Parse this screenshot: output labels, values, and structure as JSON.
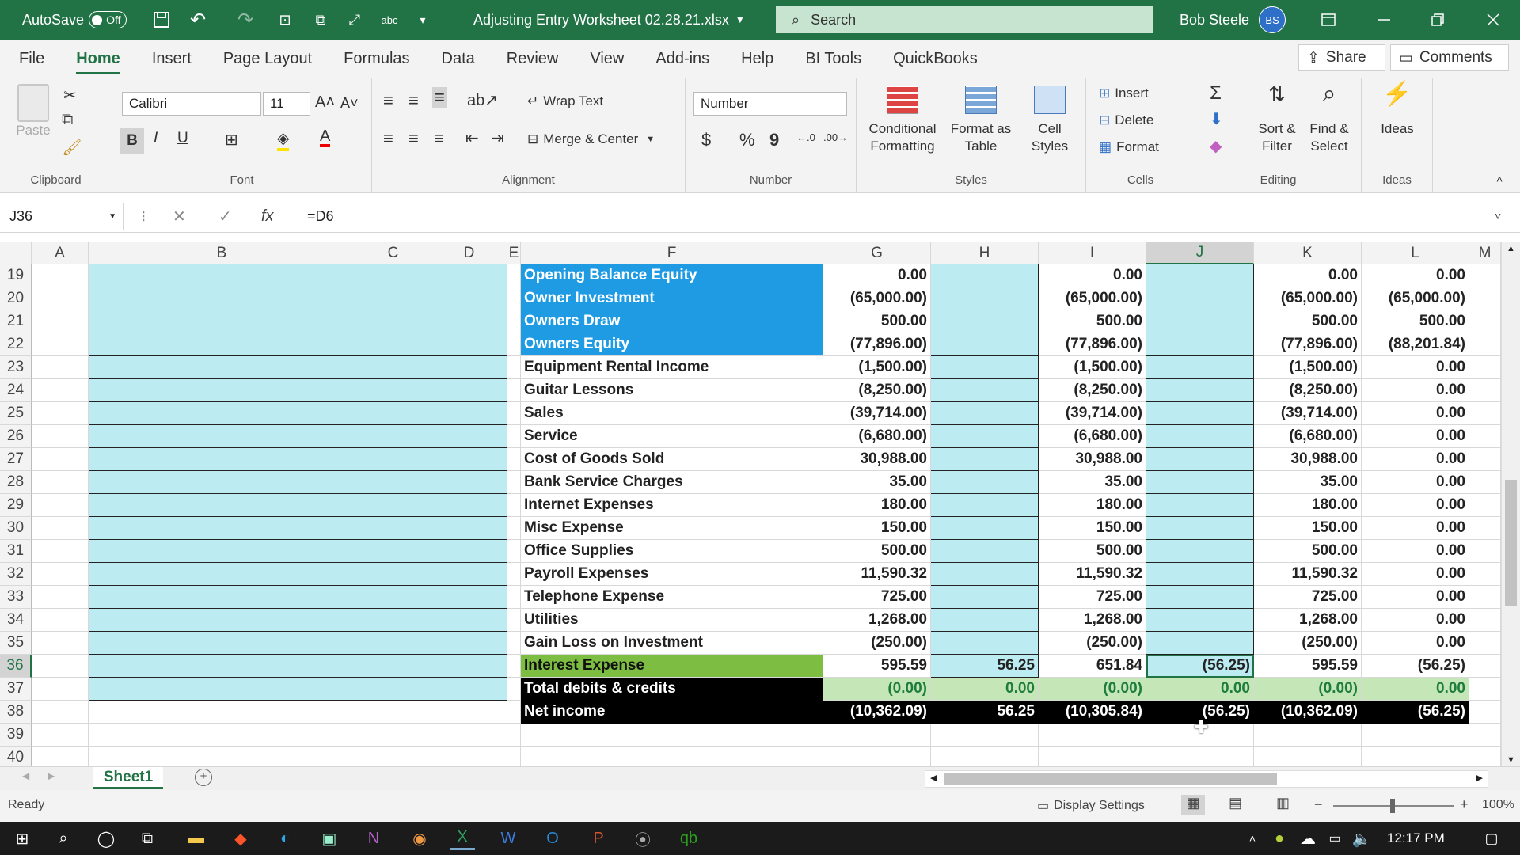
{
  "titlebar": {
    "autosave_label": "AutoSave",
    "autosave_state": "Off",
    "filename": "Adjusting Entry Worksheet 02.28.21.xlsx",
    "search_placeholder": "Search",
    "user_name": "Bob Steele",
    "user_initials": "BS"
  },
  "menu": {
    "items": [
      "File",
      "Home",
      "Insert",
      "Page Layout",
      "Formulas",
      "Data",
      "Review",
      "View",
      "Add-ins",
      "Help",
      "BI Tools",
      "QuickBooks"
    ],
    "share": "Share",
    "comments": "Comments"
  },
  "ribbon": {
    "clipboard": {
      "paste": "Paste",
      "label": "Clipboard"
    },
    "font": {
      "name": "Calibri",
      "size": "11",
      "label": "Font",
      "bold": "B",
      "italic": "I",
      "underline": "U"
    },
    "alignment": {
      "wrap": "Wrap Text",
      "merge": "Merge & Center",
      "label": "Alignment"
    },
    "number": {
      "format": "Number",
      "label": "Number",
      "currency": "$",
      "percent": "%",
      "comma": "9"
    },
    "styles": {
      "conditional": "Conditional",
      "conditional2": "Formatting",
      "format_table": "Format as",
      "format_table2": "Table",
      "cell_styles": "Cell",
      "cell_styles2": "Styles",
      "label": "Styles"
    },
    "cells": {
      "insert": "Insert",
      "delete": "Delete",
      "format": "Format",
      "label": "Cells"
    },
    "editing": {
      "sort": "Sort &",
      "sort2": "Filter",
      "find": "Find &",
      "find2": "Select",
      "label": "Editing"
    },
    "ideas": {
      "ideas": "Ideas",
      "label": "Ideas"
    }
  },
  "formula_bar": {
    "name_box": "J36",
    "formula": "=D6",
    "fx": "fx"
  },
  "columns": [
    "A",
    "B",
    "C",
    "D",
    "E",
    "F",
    "G",
    "H",
    "I",
    "J",
    "K",
    "L",
    "M"
  ],
  "rows": [
    {
      "n": "19",
      "f": "Opening Balance Equity",
      "g": "0.00",
      "h": "",
      "i": "0.00",
      "j": "",
      "k": "0.00",
      "l": "0.00",
      "style": "blue"
    },
    {
      "n": "20",
      "f": "Owner Investment",
      "g": "(65,000.00)",
      "h": "",
      "i": "(65,000.00)",
      "j": "",
      "k": "(65,000.00)",
      "l": "(65,000.00)",
      "style": "blue"
    },
    {
      "n": "21",
      "f": "Owners Draw",
      "g": "500.00",
      "h": "",
      "i": "500.00",
      "j": "",
      "k": "500.00",
      "l": "500.00",
      "style": "blue"
    },
    {
      "n": "22",
      "f": "Owners Equity",
      "g": "(77,896.00)",
      "h": "",
      "i": "(77,896.00)",
      "j": "",
      "k": "(77,896.00)",
      "l": "(88,201.84)",
      "style": "blue"
    },
    {
      "n": "23",
      "f": "Equipment Rental Income",
      "g": "(1,500.00)",
      "h": "",
      "i": "(1,500.00)",
      "j": "",
      "k": "(1,500.00)",
      "l": "0.00",
      "style": ""
    },
    {
      "n": "24",
      "f": "Guitar Lessons",
      "g": "(8,250.00)",
      "h": "",
      "i": "(8,250.00)",
      "j": "",
      "k": "(8,250.00)",
      "l": "0.00",
      "style": ""
    },
    {
      "n": "25",
      "f": "Sales",
      "g": "(39,714.00)",
      "h": "",
      "i": "(39,714.00)",
      "j": "",
      "k": "(39,714.00)",
      "l": "0.00",
      "style": ""
    },
    {
      "n": "26",
      "f": "Service",
      "g": "(6,680.00)",
      "h": "",
      "i": "(6,680.00)",
      "j": "",
      "k": "(6,680.00)",
      "l": "0.00",
      "style": ""
    },
    {
      "n": "27",
      "f": "Cost of Goods Sold",
      "g": "30,988.00",
      "h": "",
      "i": "30,988.00",
      "j": "",
      "k": "30,988.00",
      "l": "0.00",
      "style": ""
    },
    {
      "n": "28",
      "f": "Bank Service Charges",
      "g": "35.00",
      "h": "",
      "i": "35.00",
      "j": "",
      "k": "35.00",
      "l": "0.00",
      "style": ""
    },
    {
      "n": "29",
      "f": "Internet Expenses",
      "g": "180.00",
      "h": "",
      "i": "180.00",
      "j": "",
      "k": "180.00",
      "l": "0.00",
      "style": ""
    },
    {
      "n": "30",
      "f": "Misc Expense",
      "g": "150.00",
      "h": "",
      "i": "150.00",
      "j": "",
      "k": "150.00",
      "l": "0.00",
      "style": ""
    },
    {
      "n": "31",
      "f": "Office Supplies",
      "g": "500.00",
      "h": "",
      "i": "500.00",
      "j": "",
      "k": "500.00",
      "l": "0.00",
      "style": ""
    },
    {
      "n": "32",
      "f": "Payroll Expenses",
      "g": "11,590.32",
      "h": "",
      "i": "11,590.32",
      "j": "",
      "k": "11,590.32",
      "l": "0.00",
      "style": ""
    },
    {
      "n": "33",
      "f": "Telephone Expense",
      "g": "725.00",
      "h": "",
      "i": "725.00",
      "j": "",
      "k": "725.00",
      "l": "0.00",
      "style": ""
    },
    {
      "n": "34",
      "f": "Utilities",
      "g": "1,268.00",
      "h": "",
      "i": "1,268.00",
      "j": "",
      "k": "1,268.00",
      "l": "0.00",
      "style": ""
    },
    {
      "n": "35",
      "f": "Gain Loss on Investment",
      "g": "(250.00)",
      "h": "",
      "i": "(250.00)",
      "j": "",
      "k": "(250.00)",
      "l": "0.00",
      "style": ""
    },
    {
      "n": "36",
      "f": "Interest Expense",
      "g": "595.59",
      "h": "56.25",
      "i": "651.84",
      "j": "(56.25)",
      "k": "595.59",
      "l": "(56.25)",
      "style": "green"
    },
    {
      "n": "37",
      "f": "Total debits & credits",
      "g": "(0.00)",
      "h": "0.00",
      "i": "(0.00)",
      "j": "0.00",
      "k": "(0.00)",
      "l": "0.00",
      "style": "total"
    },
    {
      "n": "38",
      "f": "Net income",
      "g": "(10,362.09)",
      "h": "56.25",
      "i": "(10,305.84)",
      "j": "(56.25)",
      "k": "(10,362.09)",
      "l": "(56.25)",
      "style": "net"
    },
    {
      "n": "39",
      "f": "",
      "g": "",
      "h": "",
      "i": "",
      "j": "",
      "k": "",
      "l": "",
      "style": "empty"
    },
    {
      "n": "40",
      "f": "",
      "g": "",
      "h": "",
      "i": "",
      "j": "",
      "k": "",
      "l": "",
      "style": "empty"
    }
  ],
  "sheet_tab": "Sheet1",
  "status": {
    "ready": "Ready",
    "display_settings": "Display Settings",
    "zoom": "100%"
  },
  "taskbar": {
    "time": "12:17 PM"
  },
  "colors": {
    "excel_green": "#217346",
    "equity_blue": "#1e9be3",
    "highlight_green": "#7cbd42",
    "cyan_fill": "#bdebf2"
  }
}
